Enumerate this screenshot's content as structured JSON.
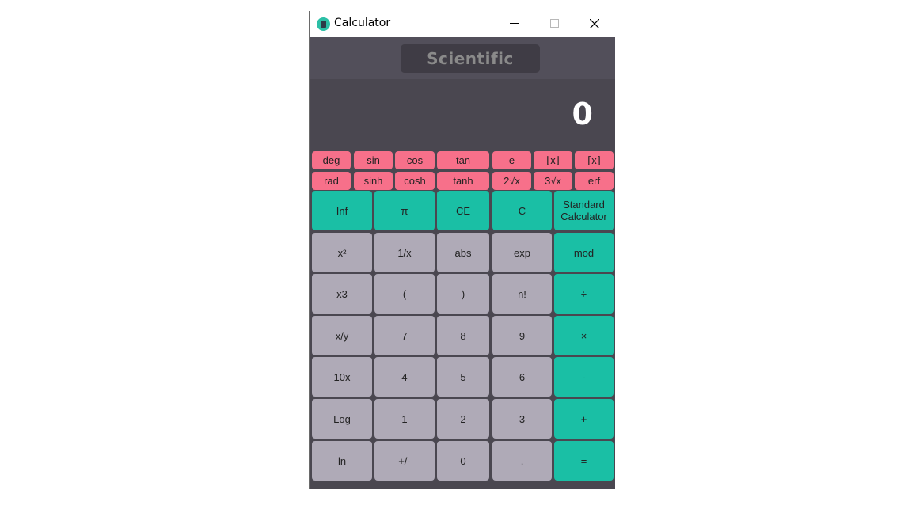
{
  "window": {
    "title": "Calculator"
  },
  "mode": {
    "label": "Scientific"
  },
  "display": {
    "value": "0"
  },
  "scientific_rows": [
    [
      "deg",
      "sin",
      "cos",
      "tan",
      "e",
      "⌊x⌋",
      "⌈x⌉"
    ],
    [
      "rad",
      "sinh",
      "cosh",
      "tanh",
      "2√x",
      "3√x",
      "erf"
    ]
  ],
  "keypad_rows": [
    [
      "Inf",
      "π",
      "CE",
      "C",
      "Standard\nCalculator"
    ],
    [
      "x²",
      "1/x",
      "abs",
      "exp",
      "mod"
    ],
    [
      "x3",
      "(",
      ")",
      "n!",
      "÷"
    ],
    [
      "x/y",
      "7",
      "8",
      "9",
      "×"
    ],
    [
      "10x",
      "4",
      "5",
      "6",
      "-"
    ],
    [
      "Log",
      "1",
      "2",
      "3",
      "+"
    ],
    [
      "ln",
      "+/-",
      "0",
      ".",
      "="
    ]
  ],
  "colors": {
    "scientific_key": "#f7708a",
    "accent_key": "#1abfa5",
    "number_key": "#afaab7",
    "background": "#4a4750"
  },
  "icons": {
    "app": "calculator-icon",
    "minimize": "minimize-icon",
    "maximize": "maximize-icon",
    "close": "close-icon"
  }
}
